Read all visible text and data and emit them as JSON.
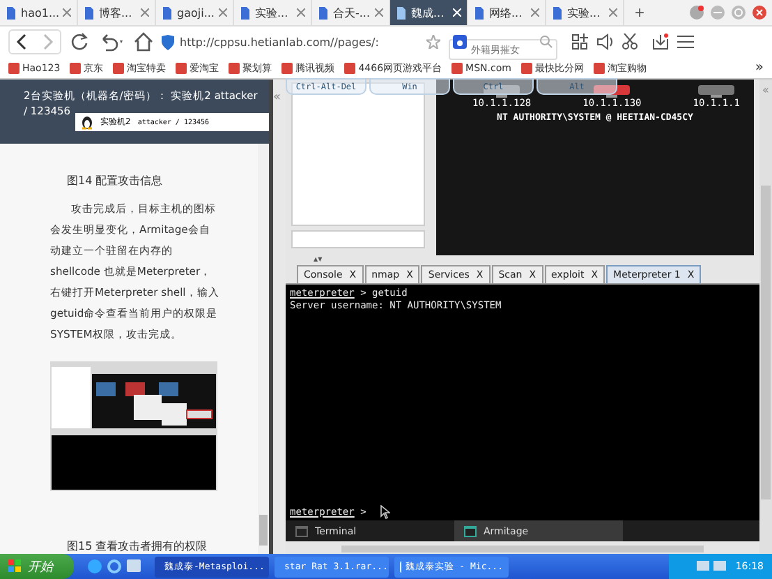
{
  "browser_tabs": [
    {
      "title": "hao1...",
      "selected": false
    },
    {
      "title": "博客...",
      "selected": false
    },
    {
      "title": "gaoji...",
      "selected": false
    },
    {
      "title": "实验...",
      "selected": false
    },
    {
      "title": "合天-...",
      "selected": false
    },
    {
      "title": "魏成...",
      "selected": true
    },
    {
      "title": "网络...",
      "selected": false
    },
    {
      "title": "实验...",
      "selected": false
    }
  ],
  "new_tab": "+",
  "address_bar": {
    "url": "http://cppsu.hetianlab.com//pages/:"
  },
  "search": {
    "placeholder": "外籍男摧女"
  },
  "bookmarks": [
    "Hao123",
    "京东",
    "淘宝特卖",
    "爱淘宝",
    "聚划算",
    "腾讯视频",
    "4466网页游戏平台",
    "MSN.com",
    "最快比分网",
    "淘宝购物"
  ],
  "bookmarks_more": "»",
  "lab_header": {
    "text": "2台实验机（机器名/密码）： 实验机2  attacker / 123456"
  },
  "machine_select": {
    "name": "实验机2",
    "credentials": "attacker / 123456"
  },
  "collapse": "«",
  "article": {
    "caption_top": "图14 配置攻击信息",
    "paragraph": "攻击完成后，目标主机的图标会发生明显变化，Armitage会自动建立一个驻留在内存的shellcode 也就是Meterpreter，右键打开Meterpreter shell，输入getuid命令查看当前用户的权限是SYSTEM权限，攻击完成。",
    "caption_bottom": "图15 查看攻击者拥有的权限"
  },
  "remote": {
    "keys": [
      "Ctrl-Alt-Del",
      "Win",
      "Ctrl",
      "Alt"
    ],
    "collapse": "«"
  },
  "hosts": [
    {
      "ip": "10.1.1.128",
      "compromised": false
    },
    {
      "ip": "10.1.1.130",
      "compromised": true
    },
    {
      "ip": "10.1.1.1",
      "compromised": false
    }
  ],
  "session_label": "NT AUTHORITY\\SYSTEM @ HEETIAN-CD45CY",
  "split_arrows": "▲▼",
  "tabs": [
    {
      "label": "Console",
      "close": "X",
      "selected": false
    },
    {
      "label": "nmap",
      "close": "X",
      "selected": false
    },
    {
      "label": "Services",
      "close": "X",
      "selected": false
    },
    {
      "label": "Scan",
      "close": "X",
      "selected": false
    },
    {
      "label": "exploit",
      "close": "X",
      "selected": false
    },
    {
      "label": "Meterpreter 1",
      "close": "X",
      "selected": true
    }
  ],
  "terminal": [
    {
      "kind": "command",
      "prompt": "meterpreter",
      "text": " > getuid"
    },
    {
      "kind": "output",
      "text": "Server username: NT AUTHORITY\\SYSTEM"
    }
  ],
  "terminal_prompt": {
    "prompt": "meterpreter",
    "text": " >"
  },
  "bottom_tabs": [
    {
      "label": "Terminal",
      "selected": false
    },
    {
      "label": "Armitage",
      "selected": true
    }
  ],
  "taskbar": {
    "start": "开始",
    "tasks": [
      {
        "title": "魏成泰-Metasploi...",
        "selected": true
      },
      {
        "title": "star Rat 3.1.rar...",
        "selected": false
      },
      {
        "title": "魏成泰实验 - Mic...",
        "selected": false
      }
    ],
    "clock": "16:18"
  }
}
